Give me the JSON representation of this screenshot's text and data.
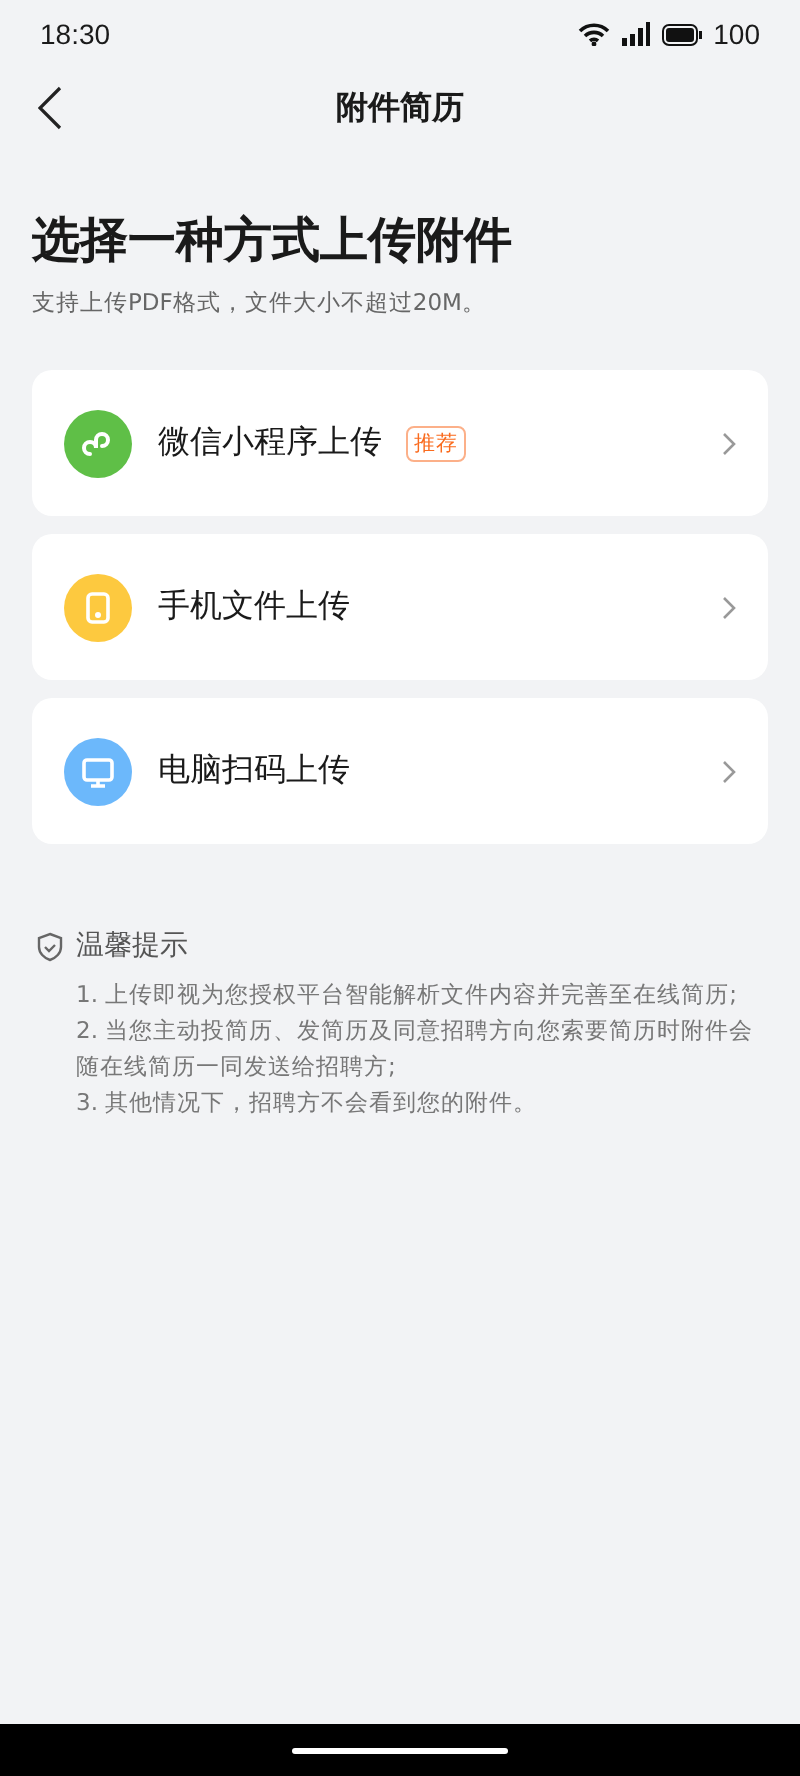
{
  "status_bar": {
    "time": "18:30",
    "battery": "100"
  },
  "nav": {
    "title": "附件简历"
  },
  "heading": "选择一种方式上传附件",
  "subtitle": "支持上传PDF格式，文件大小不超过20M。",
  "options": [
    {
      "kind": "wechat",
      "label": "微信小程序上传",
      "badge": "推荐"
    },
    {
      "kind": "phone",
      "label": "手机文件上传"
    },
    {
      "kind": "computer",
      "label": "电脑扫码上传"
    }
  ],
  "tips": {
    "title": "温馨提示",
    "items": [
      "1. 上传即视为您授权平台智能解析文件内容并完善至在线简历;",
      "2. 当您主动投简历、发简历及同意招聘方向您索要简历时附件会随在线简历一同发送给招聘方;",
      "3. 其他情况下，招聘方不会看到您的附件。"
    ]
  }
}
